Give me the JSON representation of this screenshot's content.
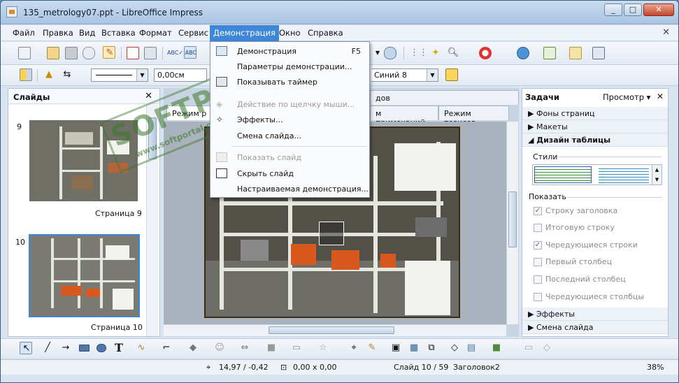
{
  "window": {
    "title": "135_metrology07.ppt - LibreOffice Impress",
    "buttons": [
      "_",
      "□",
      "✕"
    ]
  },
  "menubar": {
    "items": [
      "Файл",
      "Правка",
      "Вид",
      "Вставка",
      "Формат",
      "Сервис",
      "Демонстрация",
      "Окно",
      "Справка"
    ],
    "active": "Демонстрация"
  },
  "toolbar2": {
    "line_width": "0,00см",
    "color": "Синий 8"
  },
  "slides_panel": {
    "title": "Слайды",
    "slides": [
      {
        "num": "9",
        "caption": "Страница 9"
      },
      {
        "num": "10",
        "caption": "Страница 10"
      }
    ]
  },
  "center": {
    "tabs_top": [
      "Режим р",
      "дов"
    ],
    "tabs_second": [
      "м примечаний",
      "Режим тезисов"
    ]
  },
  "demo_menu": {
    "items": [
      {
        "label": "Демонстрация",
        "shortcut": "F5",
        "disabled": false
      },
      {
        "label": "Параметры демонстрации...",
        "shortcut": "",
        "disabled": false
      },
      {
        "label": "Показывать таймер",
        "shortcut": "",
        "disabled": false
      },
      {
        "label": "Действие по щелчку мыши...",
        "shortcut": "",
        "disabled": true
      },
      {
        "label": "Эффекты...",
        "shortcut": "",
        "disabled": false
      },
      {
        "label": "Смена слайда...",
        "shortcut": "",
        "disabled": false
      },
      {
        "label": "Показать слайд",
        "shortcut": "",
        "disabled": true
      },
      {
        "label": "Скрыть слайд",
        "shortcut": "",
        "disabled": false
      },
      {
        "label": "Настраиваемая демонстрация...",
        "shortcut": "",
        "disabled": false
      }
    ]
  },
  "tasks": {
    "title": "Задачи",
    "view": "Просмотр",
    "sections": [
      "Фоны страниц",
      "Макеты",
      "Дизайн таблицы"
    ],
    "styles_label": "Стили",
    "show_label": "Показать",
    "options": [
      {
        "label": "Строку заголовка",
        "checked": true
      },
      {
        "label": "Итоговую строку",
        "checked": false
      },
      {
        "label": "Чередующиеся строки",
        "checked": true
      },
      {
        "label": "Первый столбец",
        "checked": false
      },
      {
        "label": "Последний столбец",
        "checked": false
      },
      {
        "label": "Чередующиеся столбцы",
        "checked": false
      }
    ],
    "bottom_sections": [
      "Эффекты",
      "Смена слайда"
    ]
  },
  "status": {
    "position": "14,97 / -0,42",
    "size": "0,00 x 0,00",
    "slide": "Слайд 10 / 59",
    "layout": "Заголовок2",
    "zoom": "38%"
  },
  "watermark": {
    "text": "SOFTPORTAL",
    "url": "www.softportal.com"
  },
  "colors": {
    "accent": "#3d86d8",
    "titlebar": "#b9d0ea"
  }
}
